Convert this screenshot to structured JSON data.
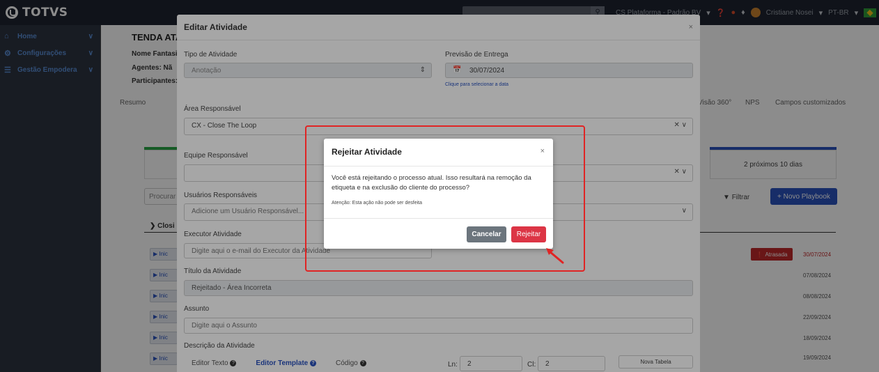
{
  "app": {
    "logo": "TOTVS",
    "nav": {
      "platform_text": "CS Plataforma - Padrão BV",
      "user_name": "Cristiane Nosei",
      "language": "PT-BR"
    }
  },
  "sidebar": {
    "items": [
      {
        "label": "Home",
        "icon": "home-icon"
      },
      {
        "label": "Configurações",
        "icon": "gear-icon"
      },
      {
        "label": "Gestão Empodera",
        "icon": "sliders-icon"
      }
    ]
  },
  "background": {
    "title": "TENDA ATA",
    "nome_fantasia": "Nome Fantasia",
    "agentes": "Agentes:  Nã",
    "participantes": "Participantes:",
    "tabs": [
      "Resumo",
      "Visão 360°",
      "NPS",
      "Campos customizados"
    ],
    "proximos": "2  próximos 10 dias",
    "procurar": "Procurar",
    "filtrar": "Filtrar",
    "novo_playbook": "+ Novo Playbook",
    "closing": "Closi",
    "play_label": "Inic",
    "atrasada": "Atrasada",
    "dates": [
      "30/07/2024",
      "07/08/2024",
      "08/08/2024",
      "22/09/2024",
      "18/09/2024",
      "19/09/2024"
    ],
    "colors": {
      "green": "#28a745",
      "blue": "#2a52be",
      "red": "#c0282a"
    }
  },
  "edit_modal": {
    "title": "Editar Atividade",
    "close": "×",
    "tipo_label": "Tipo de Atividade",
    "tipo_value": "Anotação",
    "previsao_label": "Previsão de Entrega",
    "previsao_value": "30/07/2024",
    "previsao_hint": "Clique para selecionar a data",
    "area_label": "Área Responsável",
    "area_value": "CX - Close The Loop",
    "equipe_label": "Equipe Responsável",
    "usuarios_label": "Usuários Responsáveis",
    "usuarios_placeholder": "Adicione um Usuário Responsável...",
    "executor_label": "Executor Atividade",
    "executor_placeholder": "Digite aqui o e-mail do Executor da Atividade",
    "titulo_label": "Título da Atividade",
    "titulo_value": "Rejeitado - Área Incorreta",
    "assunto_label": "Assunto",
    "assunto_placeholder": "Digite aqui o Assunto",
    "descricao_label": "Descrição da Atividade",
    "editor_texto": "Editor Texto",
    "editor_template": "Editor Template",
    "codigo": "Código",
    "ln_label": "Ln:",
    "ln_value": "2",
    "cl_label": "Cl:",
    "cl_value": "2",
    "nova_tabela": "Nova Tabela"
  },
  "reject_modal": {
    "title": "Rejeitar Atividade",
    "close": "×",
    "message": "Você está rejeitando o processo atual. Isso resultará na remoção da etiqueta e na exclusão do cliente do processo?",
    "warning": "Atenção: Esta ação não pode ser desfeita",
    "cancel_label": "Cancelar",
    "reject_label": "Rejeitar",
    "colors": {
      "cancel": "#6c757d",
      "reject": "#dc3545",
      "highlight": "#e02424"
    }
  }
}
